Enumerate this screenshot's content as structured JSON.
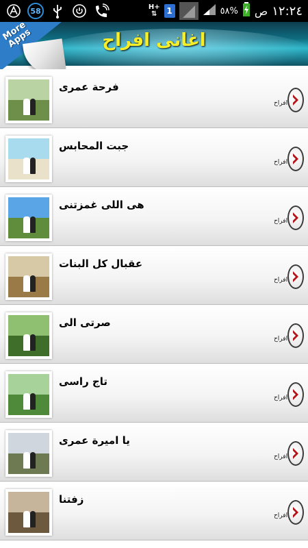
{
  "status_bar": {
    "time": "١٢:٢٤",
    "ampm": "ص",
    "battery": "٥٨%",
    "badge_count": "58",
    "sim_slot": "1",
    "network_type": "H+",
    "icons": [
      "android-icon",
      "badge-icon",
      "usb-icon",
      "power-icon",
      "call-icon",
      "sim-icon",
      "signal-icon",
      "battery-icon"
    ]
  },
  "header": {
    "title": "اغانى افراح",
    "more_apps_label": "More Apps",
    "colors": {
      "title": "#f5ee28",
      "banner_dark": "#0d3d4f",
      "banner_light": "#2bb5c9",
      "more_apps_corner": "#2e7dc8"
    }
  },
  "list": {
    "items": [
      {
        "title": "فرحة عمرى",
        "subtitle": "افراح",
        "thumb_colors": [
          "#b9d3a3",
          "#6e8f4a"
        ]
      },
      {
        "title": "جبت المحابس",
        "subtitle": "افراح",
        "thumb_colors": [
          "#a9dbee",
          "#e9e1c9"
        ]
      },
      {
        "title": "هى اللى غمزتنى",
        "subtitle": "افراح",
        "thumb_colors": [
          "#5aa5e6",
          "#5f8d3c"
        ]
      },
      {
        "title": "عقبال كل البنات",
        "subtitle": "افراح",
        "thumb_colors": [
          "#d8c9a6",
          "#9a7a46"
        ]
      },
      {
        "title": "صرتى الى",
        "subtitle": "افراح",
        "thumb_colors": [
          "#8fbf71",
          "#3f6e2b"
        ]
      },
      {
        "title": "تاج راسى",
        "subtitle": "افراح",
        "thumb_colors": [
          "#a7d39a",
          "#4f8a3a"
        ]
      },
      {
        "title": "يا اميرة عمرى",
        "subtitle": "افراح",
        "thumb_colors": [
          "#cfd6dd",
          "#6d7a52"
        ]
      },
      {
        "title": "زفتنا",
        "subtitle": "افراح",
        "thumb_colors": [
          "#c6b59a",
          "#6d5a3e"
        ]
      }
    ]
  }
}
